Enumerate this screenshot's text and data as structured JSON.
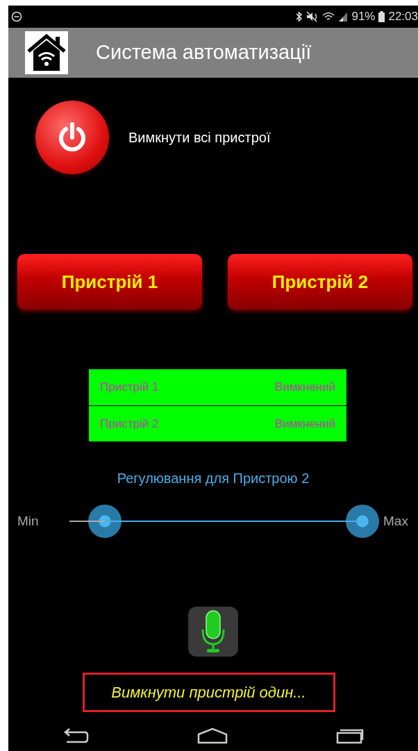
{
  "status_bar": {
    "battery": "91%",
    "time": "22:03"
  },
  "app_bar": {
    "title": "Система автоматизації"
  },
  "power": {
    "label": "Вимкнути всі пристрої"
  },
  "device_buttons": [
    {
      "label": "Пристрій 1"
    },
    {
      "label": "Пристрій 2"
    }
  ],
  "device_status": [
    {
      "name": "Пристрій 1",
      "state": "Вимкнений"
    },
    {
      "name": "Пристрій 2",
      "state": "Вимкнений"
    }
  ],
  "regulation": {
    "title": "Регулювання для Пристрою 2",
    "min_label": "Min",
    "max_label": "Max",
    "thumbs": [
      {
        "level": 0.12
      },
      {
        "level": 1
      }
    ]
  },
  "speech": {
    "text": "Вимкнути пристрій один..."
  }
}
